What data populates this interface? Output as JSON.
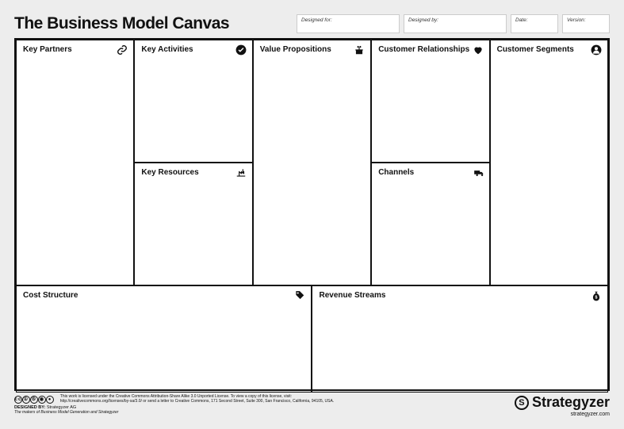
{
  "title": "The Business Model Canvas",
  "meta": {
    "designed_for_label": "Designed for:",
    "designed_by_label": "Designed by:",
    "date_label": "Date:",
    "version_label": "Version:"
  },
  "blocks": {
    "key_partners": "Key Partners",
    "key_activities": "Key Activities",
    "key_resources": "Key Resources",
    "value_propositions": "Value Propositions",
    "customer_relationships": "Customer Relationships",
    "channels": "Channels",
    "customer_segments": "Customer Segments",
    "cost_structure": "Cost Structure",
    "revenue_streams": "Revenue Streams"
  },
  "footer": {
    "license_line1": "This work is licensed under the Creative Commons Attribution-Share Alike 3.0 Unported License. To view a copy of this license, visit:",
    "license_line2": "http://creativecommons.org/licenses/by-sa/3.0/ or send a letter to Creative Commons, 171 Second Street, Suite 300, San Francisco, California, 94105, USA.",
    "designed_by_prefix": "DESIGNED BY:",
    "designed_by_name": "Strategyzer AG",
    "tagline": "The makers of Business Model Generation and Strategyzer",
    "brand": "Strategyzer",
    "website": "strategyzer.com"
  }
}
